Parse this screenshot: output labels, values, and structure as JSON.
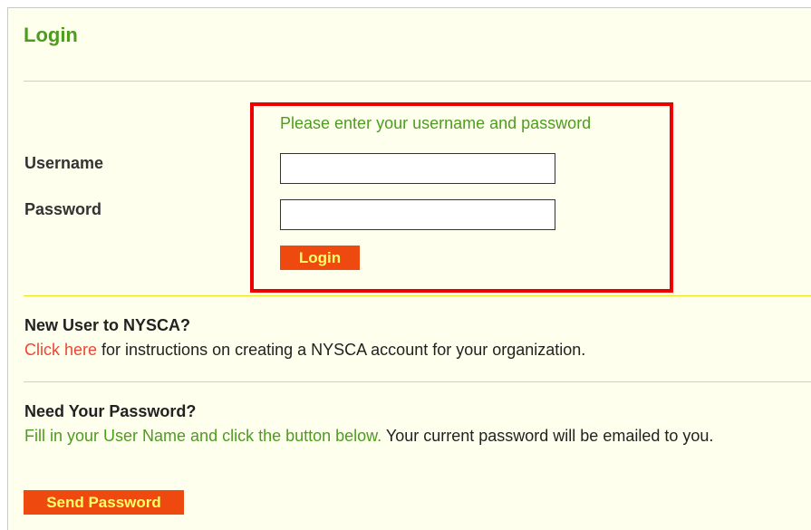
{
  "login": {
    "title": "Login",
    "prompt": "Please enter your username and password",
    "username_label": "Username",
    "password_label": "Password",
    "username_value": "",
    "password_value": "",
    "button_label": "Login"
  },
  "new_user": {
    "heading": "New User to NYSCA?",
    "link_text": "Click here",
    "text": " for instructions on creating a NYSCA account for your organization."
  },
  "need_password": {
    "heading": "Need Your Password?",
    "green_text": "Fill in your User Name and click the button below.",
    "text": " Your current password will be emailed to you.",
    "button_label": "Send Password"
  },
  "colors": {
    "panel_background": "#ffffee",
    "title_green": "#4d9c1f",
    "divider_yellow": "#e6e61e",
    "highlight_red": "#ee0000",
    "button_orange": "#ee4a0f",
    "button_text_yellow": "#ffff66",
    "link_red": "#ee4433"
  }
}
